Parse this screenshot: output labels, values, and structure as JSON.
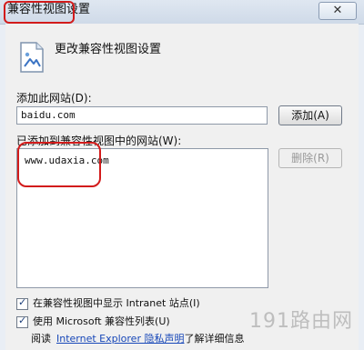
{
  "window": {
    "title": "兼容性视图设置",
    "close_glyph": "✕"
  },
  "header": {
    "icon": "compatibility-view-icon",
    "text": "更改兼容性视图设置"
  },
  "add_site": {
    "label": "添加此网站(D):",
    "value": "baidu.com",
    "button_label": "添加(A)"
  },
  "site_list": {
    "label": "已添加到兼容性视图中的网站(W):",
    "items": [
      "www.udaxia.com"
    ],
    "remove_label": "删除(R)"
  },
  "options": {
    "intranet": {
      "label": "在兼容性视图中显示 Intranet 站点(I)",
      "checked": true
    },
    "ms_list": {
      "label": "使用 Microsoft 兼容性列表(U)",
      "checked": true
    }
  },
  "footer": {
    "prefix": "阅读",
    "link": "Internet Explorer 隐私声明",
    "suffix": "了解详细信息"
  },
  "watermark": "191路由网",
  "colors": {
    "highlight_ring": "#d21b1b",
    "link": "#1747b8"
  }
}
